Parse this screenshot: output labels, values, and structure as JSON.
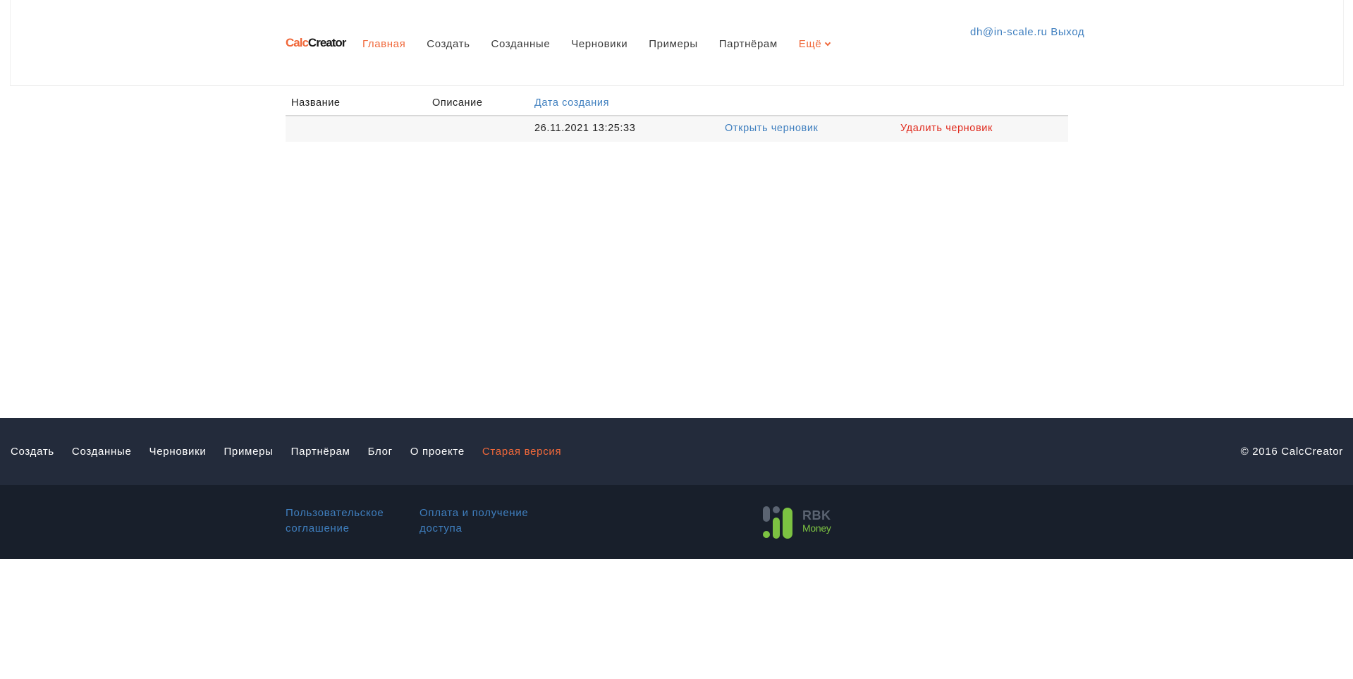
{
  "header": {
    "logo": {
      "part1": "Calc",
      "part2": "Creator"
    },
    "nav": [
      {
        "label": "Главная",
        "active": true
      },
      {
        "label": "Создать"
      },
      {
        "label": "Созданные"
      },
      {
        "label": "Черновики"
      },
      {
        "label": "Примеры"
      },
      {
        "label": "Партнёрам"
      }
    ],
    "more_label": "Ещё",
    "user_email": "dh@in-scale.ru",
    "logout_label": "Выход"
  },
  "table": {
    "columns": [
      "Название",
      "Описание",
      "Дата создания"
    ],
    "rows": [
      {
        "name": "",
        "description": "",
        "created": "26.11.2021 13:25:33",
        "open_label": "Открыть черновик",
        "delete_label": "Удалить черновик"
      }
    ]
  },
  "footer": {
    "nav": [
      "Создать",
      "Созданные",
      "Черновики",
      "Примеры",
      "Партнёрам",
      "Блог",
      "О проекте"
    ],
    "old_version_label": "Старая версия",
    "copyright": "© 2016 CalcCreator",
    "links": [
      {
        "line1": "Пользовательское",
        "line2": "соглашение"
      },
      {
        "line1": "Оплата и получение",
        "line2": "доступа"
      }
    ],
    "payment_logo": {
      "top": "RBK",
      "bottom": "Money"
    }
  },
  "colors": {
    "accent": "#f0683a",
    "link": "#3f7fbf",
    "danger": "#e0291c",
    "footer_top": "#232b3b",
    "footer_bottom": "#181f2b",
    "rbk_green": "#7cc242"
  }
}
